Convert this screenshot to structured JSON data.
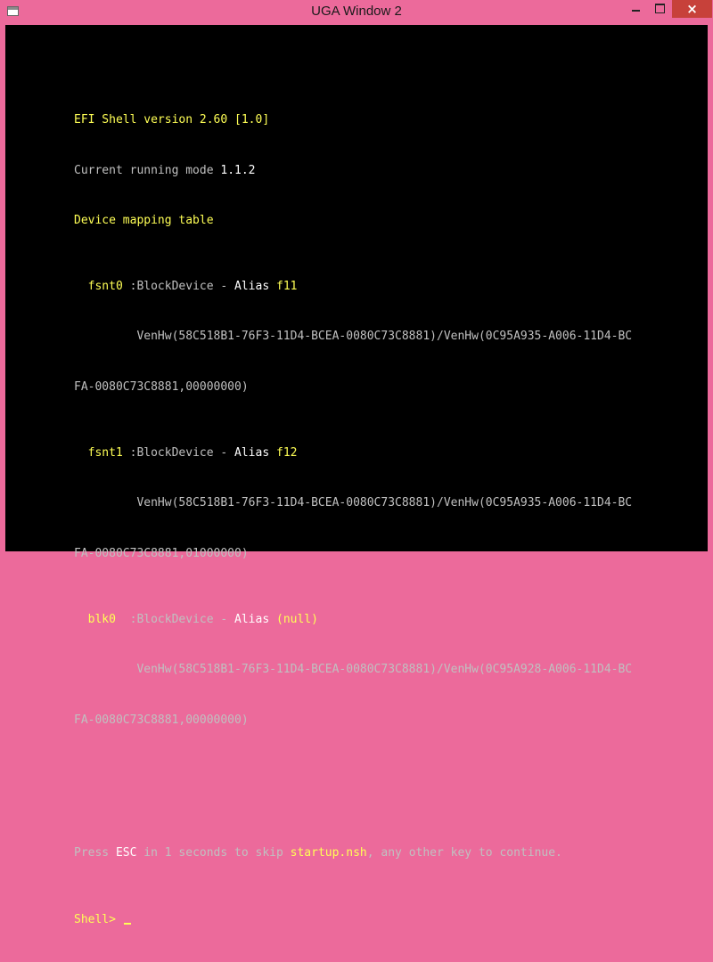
{
  "window": {
    "title": "UGA Window 2",
    "close_glyph": "×",
    "controls": [
      "minimize",
      "maximize",
      "close"
    ]
  },
  "console": {
    "shell_version": "EFI Shell version 2.60 [1.0]",
    "mode_label": "Current running mode ",
    "mode_value": "1.1.2",
    "mapping_heading": "Device mapping table",
    "devices": [
      {
        "name": "  fsnt0",
        "sep": " :BlockDevice - ",
        "alias_label": "Alias ",
        "alias": "f11",
        "path1": "         VenHw(58C518B1-76F3-11D4-BCEA-0080C73C8881)/VenHw(0C95A935-A006-11D4-BC",
        "path2": "FA-0080C73C8881,00000000)"
      },
      {
        "name": "  fsnt1",
        "sep": " :BlockDevice - ",
        "alias_label": "Alias ",
        "alias": "f12",
        "path1": "         VenHw(58C518B1-76F3-11D4-BCEA-0080C73C8881)/VenHw(0C95A935-A006-11D4-BC",
        "path2": "FA-0080C73C8881,01000000)"
      },
      {
        "name": "  blk0 ",
        "sep": " :BlockDevice - ",
        "alias_label": "Alias ",
        "alias": "(null)",
        "path1": "         VenHw(58C518B1-76F3-11D4-BCEA-0080C73C8881)/VenHw(0C95A928-A006-11D4-BC",
        "path2": "FA-0080C73C8881,00000000)"
      }
    ],
    "startup": {
      "press": "Press ",
      "esc": "ESC",
      "in_text": " in 1 seconds to skip ",
      "script": "startup.nsh",
      "rest": ", any other key to continue."
    },
    "prompt": "Shell> "
  },
  "colors": {
    "window_frame": "#ec6a9b",
    "close_button": "#c7413a",
    "console_bg": "#000000",
    "text_yellow": "#ffff55",
    "text_gray": "#c0c0c0",
    "text_white": "#ffffff"
  }
}
